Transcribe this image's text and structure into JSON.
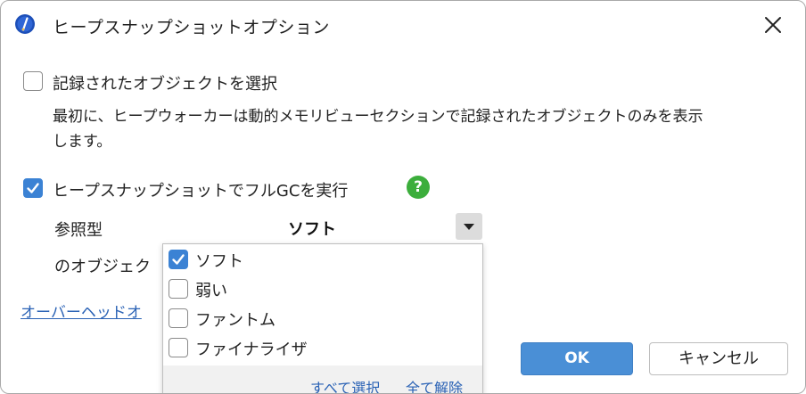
{
  "dialog": {
    "title": "ヒープスナップショットオプション",
    "icons": {
      "app": "profiler-app-icon",
      "close": "close-icon"
    }
  },
  "options": {
    "recorded_objects": {
      "label": "記録されたオブジェクトを選択",
      "checked": false,
      "description_line1": "最初に、ヒープウォーカーは動的メモリビューセクションで記録されたオブジェクトのみを表示",
      "description_line2": "します。"
    },
    "full_gc": {
      "label": "ヒープスナップショットでフルGCを実行",
      "checked": true,
      "help_icon": "?"
    },
    "reference_type": {
      "label": "参照型",
      "selected": "ソフト"
    },
    "objects_label_partial": "のオブジェク",
    "overhead_link_partial": "オーバーヘッドオ"
  },
  "dropdown": {
    "items": [
      {
        "label": "ソフト",
        "checked": true
      },
      {
        "label": "弱い",
        "checked": false
      },
      {
        "label": "ファントム",
        "checked": false
      },
      {
        "label": "ファイナライザ",
        "checked": false
      }
    ],
    "select_all": "すべて選択",
    "deselect_all": "全て解除"
  },
  "buttons": {
    "ok": "OK",
    "cancel": "キャンセル"
  },
  "colors": {
    "accent": "#3b82d4",
    "ok_button": "#4a8fd6",
    "link": "#2a62b5",
    "help": "#3cae3c"
  }
}
